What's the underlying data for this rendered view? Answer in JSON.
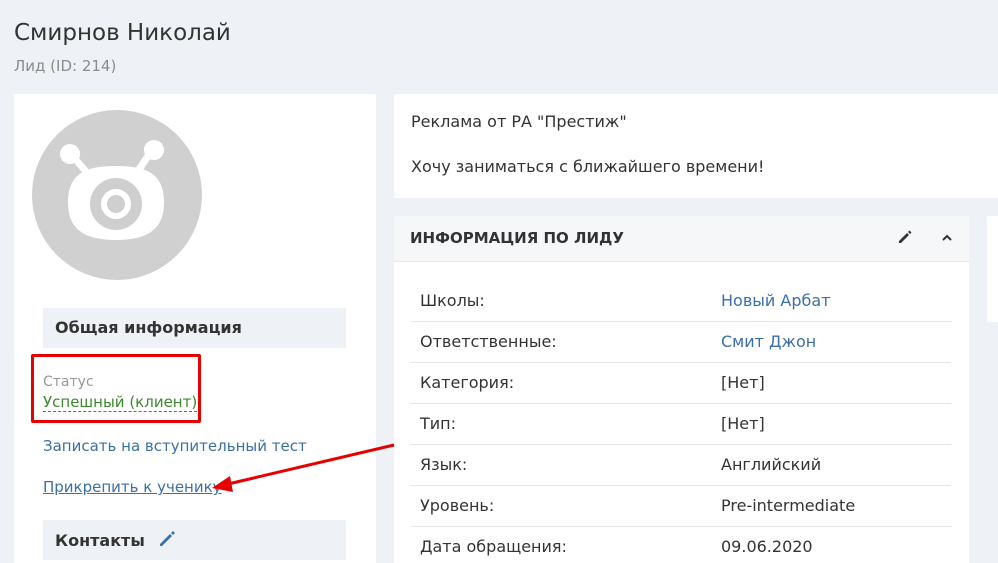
{
  "header": {
    "title": "Смирнов Николай",
    "subtitle": "Лид (ID: 214)"
  },
  "left": {
    "general_title": "Общая информация",
    "status_label": "Статус",
    "status_value": "Успешный (клиент)",
    "link_test": "Записать на вступительный тест",
    "link_attach": "Прикрепить к ученику",
    "contacts_title": "Контакты"
  },
  "note": {
    "line1": "Реклама от РА \"Престиж\"",
    "line2": "Хочу заниматься с ближайшего времени!"
  },
  "info": {
    "title": "ИНФОРМАЦИЯ ПО ЛИДУ",
    "rows": [
      {
        "label": "Школы:",
        "value": "Новый Арбат"
      },
      {
        "label": "Ответственные:",
        "value": "Смит Джон"
      },
      {
        "label": "Категория:",
        "value": "[Нет]"
      },
      {
        "label": "Тип:",
        "value": "[Нет]"
      },
      {
        "label": "Язык:",
        "value": "Английский"
      },
      {
        "label": "Уровень:",
        "value": "Pre-intermediate"
      },
      {
        "label": "Дата обращения:",
        "value": "09.06.2020"
      }
    ]
  },
  "colors": {
    "link": "#3b6fa8",
    "status": "#3c8a2e",
    "annotation": "#e60000"
  },
  "icons": [
    "avatar-monster-icon",
    "pencil-icon",
    "chevron-up-icon",
    "annotation-arrow"
  ]
}
